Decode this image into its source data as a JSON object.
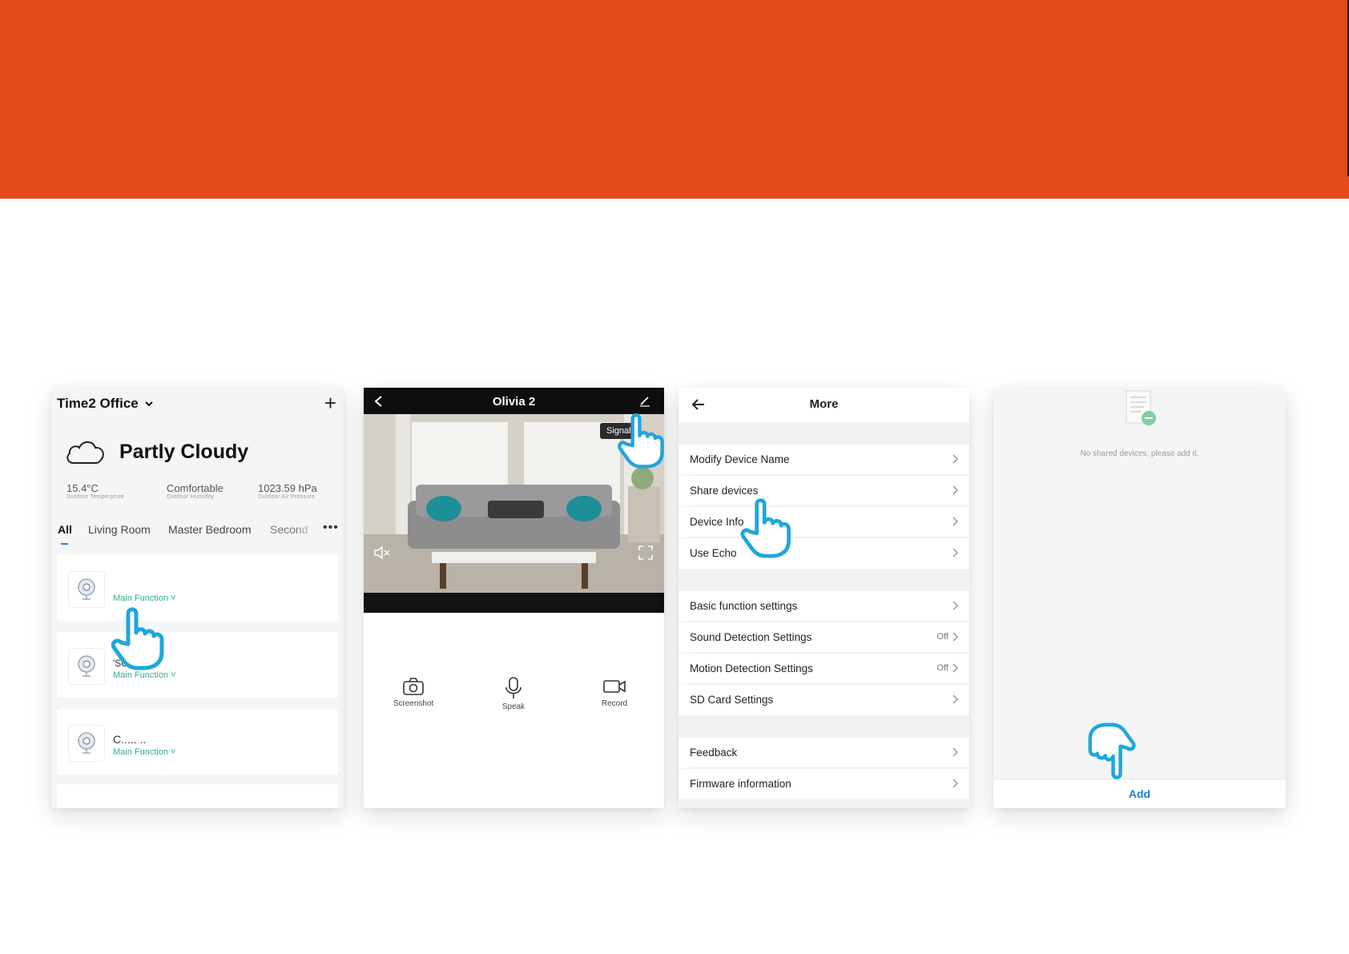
{
  "colors": {
    "banner": "#e4491a",
    "accent_teal": "#2fae8f",
    "link_blue": "#1f7fc9",
    "hand_cyan": "#1fa6dc"
  },
  "home": {
    "title": "Time2 Office",
    "weather": "Partly Cloudy",
    "stats": [
      {
        "value": "15.4°C",
        "label": "Outdoor Temperature"
      },
      {
        "value": "Comfortable",
        "label": "Outdoor Humidity"
      },
      {
        "value": "1023.59 hPa",
        "label": "Outdoor Air Pressure"
      }
    ],
    "tabs": [
      "All",
      "Living Room",
      "Master Bedroom",
      "Second"
    ],
    "devices": [
      {
        "name": "",
        "function": "Main Function"
      },
      {
        "name": "'SC",
        "function": "Main Function"
      },
      {
        "name": "C..... ..",
        "function": "Main Function"
      }
    ]
  },
  "camera": {
    "title": "Olivia 2",
    "signal": "Signal",
    "controls": [
      "Screenshot",
      "Speak",
      "Record"
    ]
  },
  "more": {
    "title": "More",
    "groups": [
      [
        {
          "label": "Modify Device Name",
          "value": ""
        },
        {
          "label": "Share devices",
          "value": ""
        },
        {
          "label": "Device Info",
          "value": ""
        },
        {
          "label": "Use Echo",
          "value": ""
        }
      ],
      [
        {
          "label": "Basic function settings",
          "value": ""
        },
        {
          "label": "Sound Detection Settings",
          "value": "Off"
        },
        {
          "label": "Motion Detection Settings",
          "value": "Off"
        },
        {
          "label": "SD Card Settings",
          "value": ""
        }
      ],
      [
        {
          "label": "Feedback",
          "value": ""
        },
        {
          "label": "Firmware information",
          "value": ""
        }
      ]
    ]
  },
  "share": {
    "empty_message": "No shared devices, please add it.",
    "add_label": "Add"
  }
}
